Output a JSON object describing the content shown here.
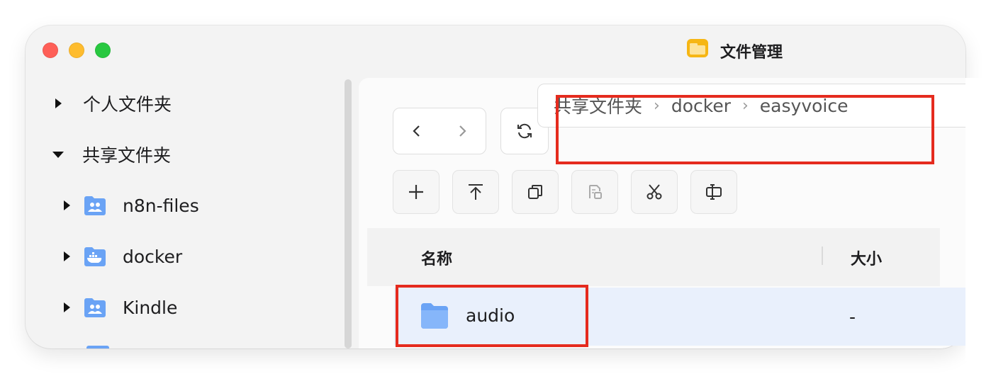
{
  "window": {
    "title": "文件管理"
  },
  "sidebar": {
    "personal": {
      "label": "个人文件夹",
      "expanded": false
    },
    "shared": {
      "label": "共享文件夹",
      "expanded": true,
      "items": [
        {
          "label": "n8n-files",
          "icon": "shared-folder-icon"
        },
        {
          "label": "docker",
          "icon": "docker-folder-icon"
        },
        {
          "label": "Kindle",
          "icon": "shared-folder-icon"
        }
      ]
    }
  },
  "breadcrumb": {
    "items": [
      "共享文件夹",
      "docker",
      "easyvoice"
    ],
    "separator": "›"
  },
  "toolbar": {
    "nav": [
      "back-icon",
      "forward-icon"
    ],
    "refresh": "refresh-icon",
    "actions": [
      "add-icon",
      "upload-icon",
      "copy-icon",
      "paste-icon",
      "cut-icon",
      "rename-icon"
    ]
  },
  "table": {
    "columns": {
      "name": "名称",
      "size": "大小"
    },
    "rows": [
      {
        "name": "audio",
        "size": "-",
        "selected": true
      }
    ]
  },
  "colors": {
    "highlight": "#e52b1e",
    "selection": "#e9f0fc",
    "folder": "#6aa3f5"
  }
}
